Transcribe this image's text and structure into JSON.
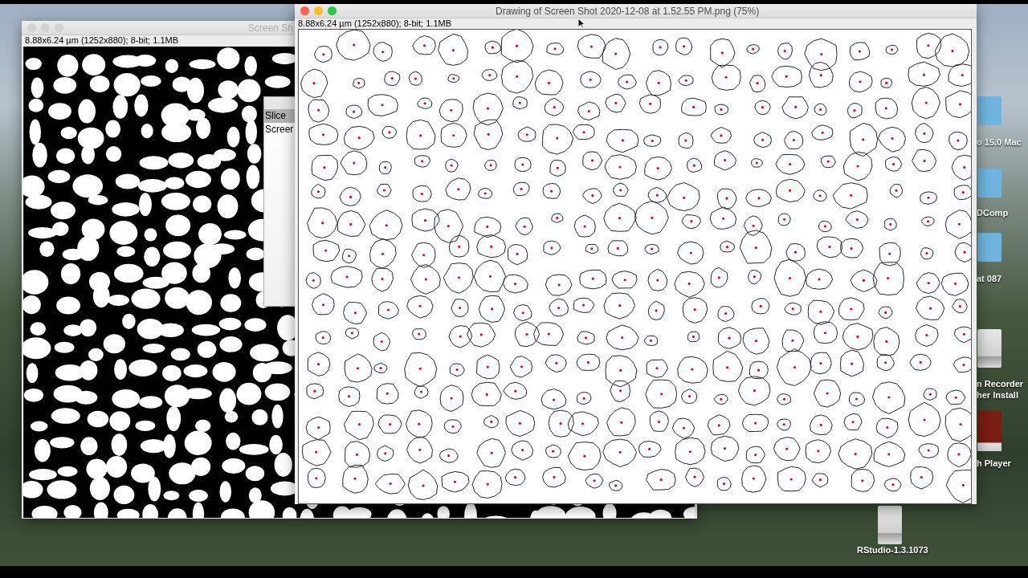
{
  "desktop": {
    "icons": [
      {
        "kind": "folder",
        "lines": [
          "o 15.0 Mac"
        ]
      },
      {
        "kind": "folder",
        "lines": [
          "DComp"
        ]
      },
      {
        "kind": "folder",
        "lines": [
          "at 087"
        ]
      },
      {
        "kind": "drive",
        "lines": [
          "n Recorder",
          "her Install"
        ]
      },
      {
        "kind": "flash",
        "lines": [
          "h Player"
        ]
      },
      {
        "kind": "drive",
        "lines": [
          "RStudio-1.3.1073"
        ]
      }
    ]
  },
  "windows": [
    {
      "kind": "binary",
      "title": "Screen Sh",
      "info": "8.88x6.24 µm (1252x880); 8-bit; 1.1MB",
      "active": false
    },
    {
      "kind": "outlines",
      "title": "Drawing of Screen Shot 2020-12-08 at 1.52.55 PM.png (75%)",
      "info": "8.88x6.24 µm (1252x880); 8-bit; 1.1MB",
      "active": true
    }
  ],
  "slice_window": {
    "items": [
      {
        "label": "Slice",
        "selected": true
      },
      {
        "label": "Screer",
        "selected": false
      }
    ]
  }
}
